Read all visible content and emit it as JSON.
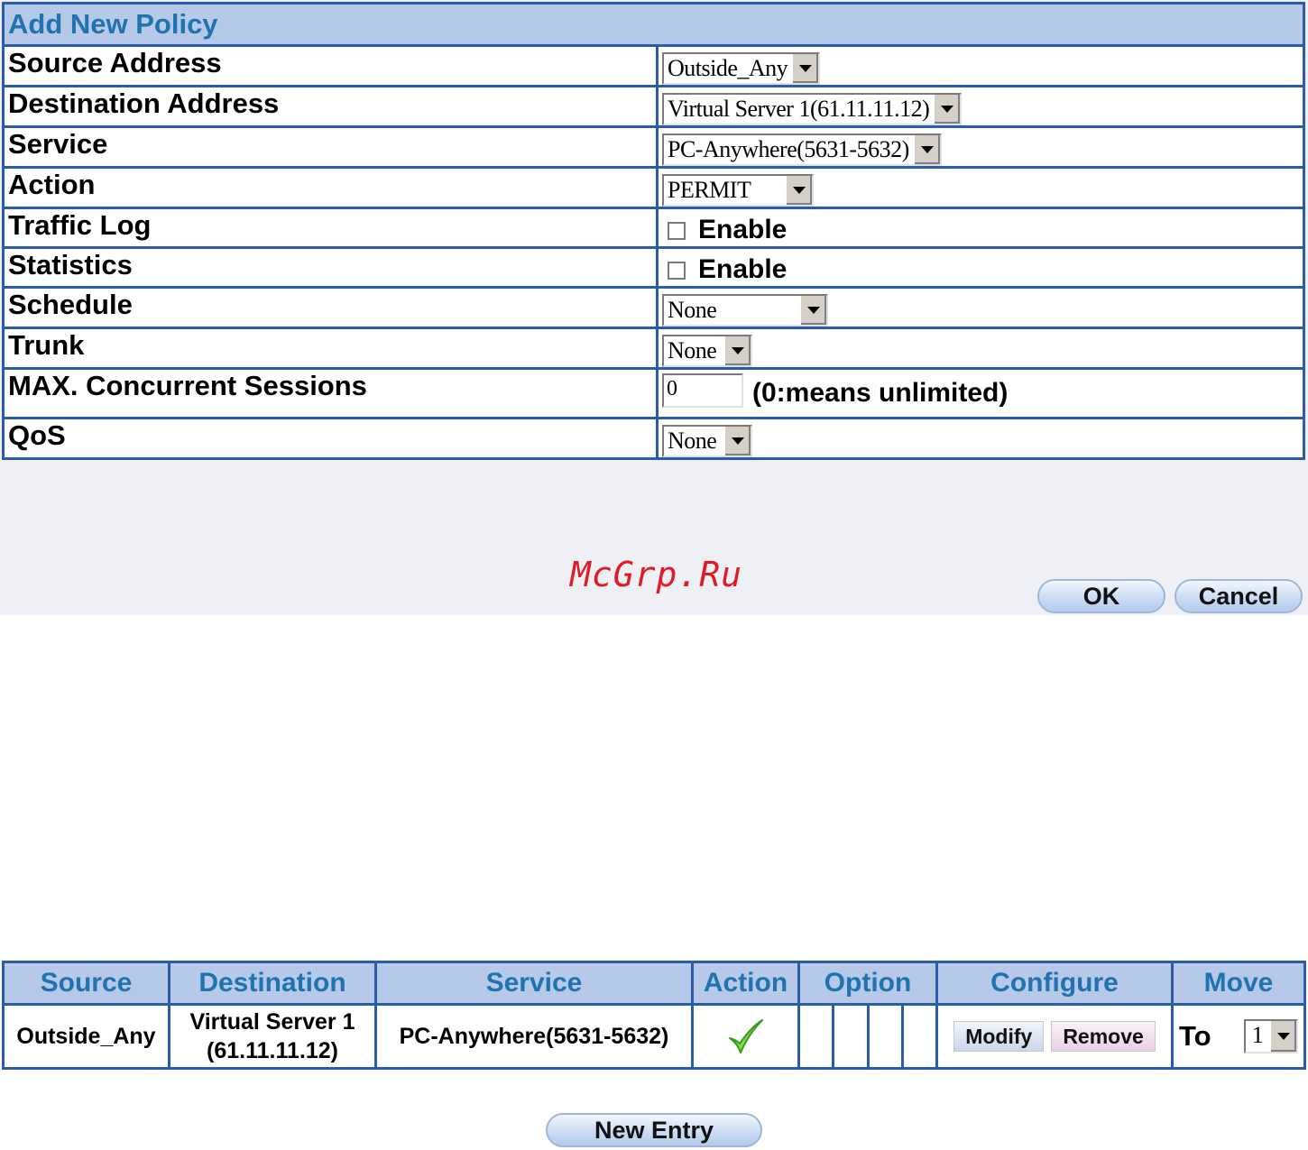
{
  "form": {
    "title": "Add New Policy",
    "source_address": {
      "label": "Source Address",
      "value": "Outside_Any"
    },
    "destination_address": {
      "label": "Destination Address",
      "value": "Virtual Server 1(61.11.11.12)"
    },
    "service": {
      "label": "Service",
      "value": "PC-Anywhere(5631-5632)"
    },
    "action": {
      "label": "Action",
      "value": "PERMIT"
    },
    "traffic_log": {
      "label": "Traffic Log",
      "option": "Enable",
      "checked": false
    },
    "statistics": {
      "label": "Statistics",
      "option": "Enable",
      "checked": false
    },
    "schedule": {
      "label": "Schedule",
      "value": "None"
    },
    "trunk": {
      "label": "Trunk",
      "value": "None"
    },
    "max_sessions": {
      "label": "MAX. Concurrent Sessions",
      "value": "0",
      "hint": "(0:means unlimited)"
    },
    "qos": {
      "label": "QoS",
      "value": "None"
    },
    "ok_label": "OK",
    "cancel_label": "Cancel"
  },
  "watermark": "McGrp.Ru",
  "policy_table": {
    "headers": [
      "Source",
      "Destination",
      "Service",
      "Action",
      "Option",
      "Configure",
      "Move"
    ],
    "rows": [
      {
        "source": "Outside_Any",
        "destination_line1": "Virtual Server 1",
        "destination_line2": "(61.11.11.12)",
        "service": "PC-Anywhere(5631-5632)",
        "action_icon": "check-icon",
        "modify_label": "Modify",
        "remove_label": "Remove",
        "move_label": "To",
        "move_value": "1"
      }
    ]
  },
  "new_entry_label": "New Entry",
  "colors": {
    "border": "#2a5ca8",
    "header_bg": "#b7c9e9",
    "header_text": "#1f73b0",
    "check": "#5ecb2a",
    "watermark": "#e01b24"
  }
}
